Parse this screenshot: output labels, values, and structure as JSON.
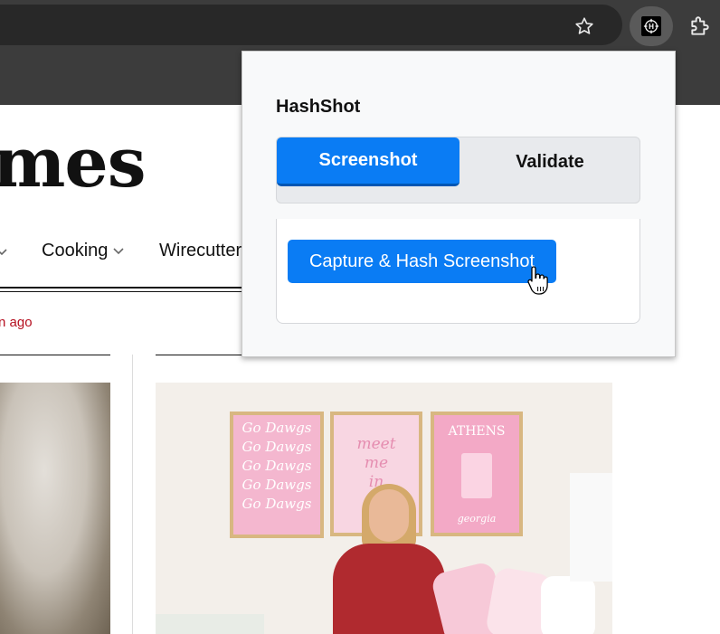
{
  "browser": {
    "icons": {
      "bookmark": "star-icon",
      "extension": "hashshot-extension-icon",
      "extensions_menu": "puzzle-icon"
    }
  },
  "page": {
    "logo_fragment": "mes",
    "nav": {
      "cooking": "Cooking",
      "wirecutter": "Wirecutter"
    },
    "timestamp_fragment": "n ago",
    "posters": {
      "left": [
        "Go Dawgs",
        "Go Dawgs",
        "Go Dawgs",
        "Go Dawgs",
        "Go Dawgs"
      ],
      "middle": [
        "meet",
        "me",
        "in"
      ],
      "right_top": "ATHENS",
      "right_bottom": "georgia"
    }
  },
  "popup": {
    "title": "HashShot",
    "tabs": {
      "screenshot": "Screenshot",
      "validate": "Validate"
    },
    "capture_button": "Capture & Hash Screenshot",
    "colors": {
      "accent": "#0a7cf4",
      "accent_dark": "#0056b3"
    }
  }
}
